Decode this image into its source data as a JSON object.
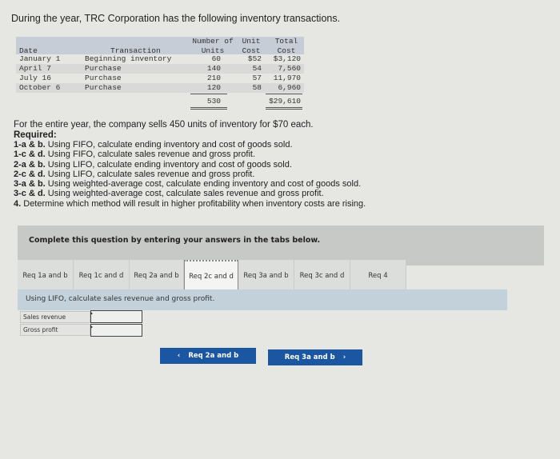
{
  "intro": "During the year, TRC Corporation has the following inventory transactions.",
  "inventory_table": {
    "headers": {
      "date": "Date",
      "transaction": "Transaction",
      "units_line1": "Number of",
      "units_line2": "Units",
      "unit_cost_line1": "Unit",
      "unit_cost_line2": "Cost",
      "total_cost_line1": "Total",
      "total_cost_line2": "Cost"
    },
    "rows": [
      {
        "date": "January 1",
        "transaction": "Beginning inventory",
        "units": "60",
        "unit_cost": "$52",
        "total_cost": "$3,120"
      },
      {
        "date": "April 7",
        "transaction": "Purchase",
        "units": "140",
        "unit_cost": "54",
        "total_cost": "7,560"
      },
      {
        "date": "July 16",
        "transaction": "Purchase",
        "units": "210",
        "unit_cost": "57",
        "total_cost": "11,970"
      },
      {
        "date": "October 6",
        "transaction": "Purchase",
        "units": "120",
        "unit_cost": "58",
        "total_cost": "6,960"
      }
    ],
    "totals": {
      "units": "530",
      "total_cost": "$29,610"
    }
  },
  "sales_text": "For the entire year, the company sells 450 units of inventory for $70 each.",
  "required_label": "Required:",
  "requirements": [
    {
      "label": "1-a & b.",
      "text": " Using FIFO, calculate ending inventory and cost of goods sold."
    },
    {
      "label": "1-c & d.",
      "text": " Using FIFO, calculate sales revenue and gross profit."
    },
    {
      "label": "2-a & b.",
      "text": " Using LIFO, calculate ending inventory and cost of goods sold."
    },
    {
      "label": "2-c & d.",
      "text": " Using LIFO, calculate sales revenue and gross profit."
    },
    {
      "label": "3-a & b.",
      "text": " Using weighted-average cost, calculate ending inventory and cost of goods sold."
    },
    {
      "label": "3-c & d.",
      "text": " Using weighted-average cost, calculate sales revenue and gross profit."
    },
    {
      "label": "4.",
      "text": " Determine which method will result in higher profitability when inventory costs are rising."
    }
  ],
  "complete_text": "Complete this question by entering your answers in the tabs below.",
  "tabs": [
    {
      "label": "Req 1a and b",
      "active": false
    },
    {
      "label": "Req 1c and d",
      "active": false
    },
    {
      "label": "Req 2a and b",
      "active": false
    },
    {
      "label": "Req 2c and d",
      "active": true
    },
    {
      "label": "Req 3a and b",
      "active": false
    },
    {
      "label": "Req 3c and d",
      "active": false
    },
    {
      "label": "Req 4",
      "active": false
    }
  ],
  "instruction": "Using LIFO, calculate sales revenue and gross profit.",
  "answer_rows": [
    {
      "label": "Sales revenue",
      "value": ""
    },
    {
      "label": "Gross profit",
      "value": ""
    }
  ],
  "nav": {
    "prev_label": "Req 2a and b",
    "next_label": "Req 3a and b",
    "prev_icon": "‹",
    "next_icon": "›"
  },
  "colors": {
    "button_blue": "#1a56a1",
    "instruction_bar": "#c3d2da",
    "table_header": "#c7cdd6"
  }
}
